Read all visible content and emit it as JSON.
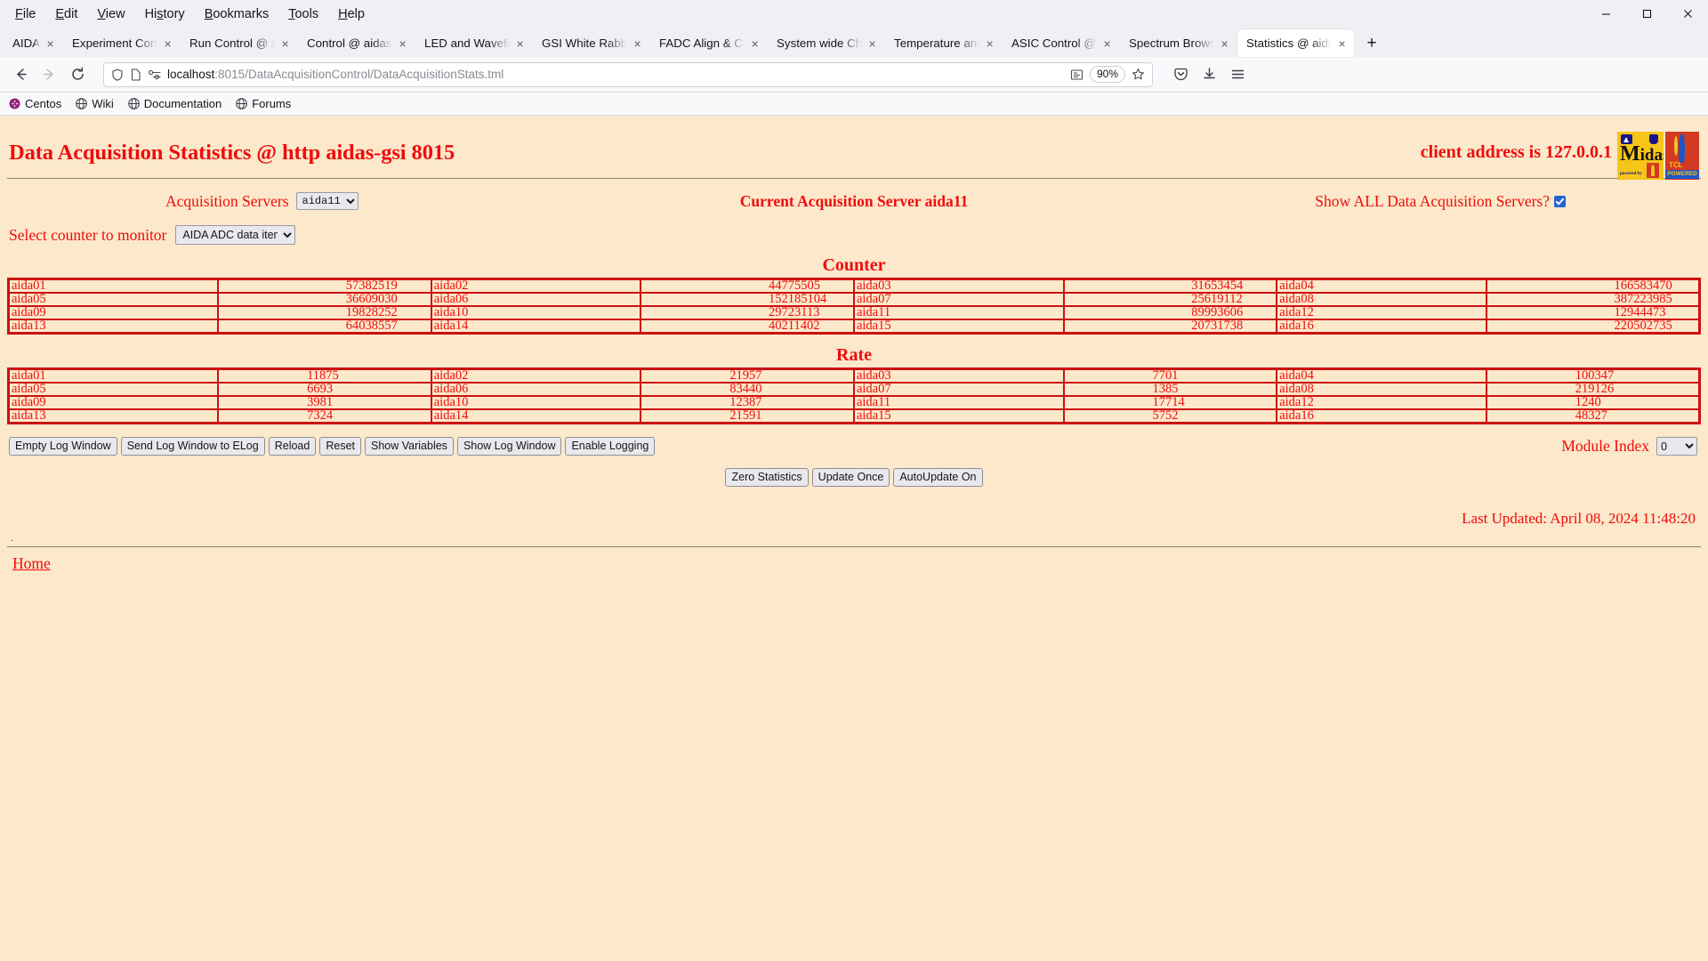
{
  "browser": {
    "menu": [
      {
        "label": "File",
        "accel": "F"
      },
      {
        "label": "Edit",
        "accel": "E"
      },
      {
        "label": "View",
        "accel": "V"
      },
      {
        "label": "History",
        "accel": "s"
      },
      {
        "label": "Bookmarks",
        "accel": "B"
      },
      {
        "label": "Tools",
        "accel": "T"
      },
      {
        "label": "Help",
        "accel": "H"
      }
    ],
    "window_controls": {
      "minimize": "—",
      "maximize": "⬜",
      "close": "✕"
    },
    "tabs": [
      {
        "label": "AIDA",
        "active": false
      },
      {
        "label": "Experiment Control",
        "active": false
      },
      {
        "label": "Run Control @ aidas-gsi",
        "active": false
      },
      {
        "label": "Control @ aidas-gsi",
        "active": false
      },
      {
        "label": "LED and Waveform",
        "active": false
      },
      {
        "label": "GSI White Rabbit Time",
        "active": false
      },
      {
        "label": "FADC Align & Control",
        "active": false
      },
      {
        "label": "System wide Checks",
        "active": false
      },
      {
        "label": "Temperature and sensors",
        "active": false
      },
      {
        "label": "ASIC Control @ aidas",
        "active": false
      },
      {
        "label": "Spectrum Browser",
        "active": false
      },
      {
        "label": "Statistics @ aidas-gsi",
        "active": true
      }
    ],
    "tab_close_label": "×",
    "new_tab_label": "+",
    "nav": {
      "back": "←",
      "forward": "→",
      "reload": "↻",
      "url_host": "localhost",
      "url_path": ":8015/DataAcquisitionControl/DataAcquisitionStats.tml",
      "zoom_level": "90%",
      "bookmark_star": "☆",
      "reader_icon": "reader-view-icon",
      "pocket_icon": "pocket-icon",
      "downloads_icon": "downloads-icon",
      "menu_icon": "app-menu-icon"
    },
    "bookmarks": [
      {
        "label": "Centos",
        "icon": "centos-icon"
      },
      {
        "label": "Wiki",
        "icon": "globe-icon"
      },
      {
        "label": "Documentation",
        "icon": "globe-icon"
      },
      {
        "label": "Forums",
        "icon": "globe-icon"
      }
    ]
  },
  "page": {
    "title": "Data Acquisition Statistics @ http aidas-gsi 8015",
    "client_address": "client address is 127.0.0.1",
    "logo_midas": {
      "word_initial": "M",
      "word_rest": "idas",
      "sub": "powered by"
    },
    "logo_tcl": {
      "name": "TCL",
      "powered": "POWERED"
    },
    "controls": {
      "acquisition_servers_label": "Acquisition Servers",
      "acquisition_servers_value": "aida11",
      "acquisition_servers_options": [
        "aida11"
      ],
      "current_server": "Current Acquisition Server aida11",
      "show_all_label": "Show ALL Data Acquisition Servers?",
      "show_all_checked": true,
      "select_counter_label": "Select counter to monitor",
      "select_counter_value": "AIDA ADC data items",
      "select_counter_options": [
        "AIDA ADC data items"
      ]
    },
    "counter_table": {
      "title": "Counter",
      "rows": [
        [
          {
            "name": "aida01",
            "value": "57382519"
          },
          {
            "name": "aida02",
            "value": "44775505"
          },
          {
            "name": "aida03",
            "value": "31653454"
          },
          {
            "name": "aida04",
            "value": "166583470"
          }
        ],
        [
          {
            "name": "aida05",
            "value": "36609030"
          },
          {
            "name": "aida06",
            "value": "152185104"
          },
          {
            "name": "aida07",
            "value": "25619112"
          },
          {
            "name": "aida08",
            "value": "387223985"
          }
        ],
        [
          {
            "name": "aida09",
            "value": "19828252"
          },
          {
            "name": "aida10",
            "value": "29723113"
          },
          {
            "name": "aida11",
            "value": "89993606"
          },
          {
            "name": "aida12",
            "value": "12944473"
          }
        ],
        [
          {
            "name": "aida13",
            "value": "64038557"
          },
          {
            "name": "aida14",
            "value": "40211402"
          },
          {
            "name": "aida15",
            "value": "20731738"
          },
          {
            "name": "aida16",
            "value": "220502735"
          }
        ]
      ]
    },
    "rate_table": {
      "title": "Rate",
      "rows": [
        [
          {
            "name": "aida01",
            "value": "11875"
          },
          {
            "name": "aida02",
            "value": "21957"
          },
          {
            "name": "aida03",
            "value": "7701"
          },
          {
            "name": "aida04",
            "value": "100347"
          }
        ],
        [
          {
            "name": "aida05",
            "value": "6693"
          },
          {
            "name": "aida06",
            "value": "83440"
          },
          {
            "name": "aida07",
            "value": "1385"
          },
          {
            "name": "aida08",
            "value": "219126"
          }
        ],
        [
          {
            "name": "aida09",
            "value": "3981"
          },
          {
            "name": "aida10",
            "value": "12387"
          },
          {
            "name": "aida11",
            "value": "17714"
          },
          {
            "name": "aida12",
            "value": "1240"
          }
        ],
        [
          {
            "name": "aida13",
            "value": "7324"
          },
          {
            "name": "aida14",
            "value": "21591"
          },
          {
            "name": "aida15",
            "value": "5752"
          },
          {
            "name": "aida16",
            "value": "48327"
          }
        ]
      ]
    },
    "buttons_row1": [
      "Empty Log Window",
      "Send Log Window to ELog",
      "Reload",
      "Reset",
      "Show Variables",
      "Show Log Window",
      "Enable Logging"
    ],
    "module_index_label": "Module Index",
    "module_index_value": "0",
    "module_index_options": [
      "0"
    ],
    "buttons_row2": [
      "Zero Statistics",
      "Update Once",
      "AutoUpdate On"
    ],
    "last_updated": "Last Updated: April 08, 2024 11:48:20",
    "tiny_dot": ".",
    "home_link": "Home"
  },
  "colors": {
    "page_bg": "#fce8cb",
    "red_text": "#f00c0c",
    "table_border": "#cc1111",
    "checkbox_accent": "#2463d6"
  }
}
